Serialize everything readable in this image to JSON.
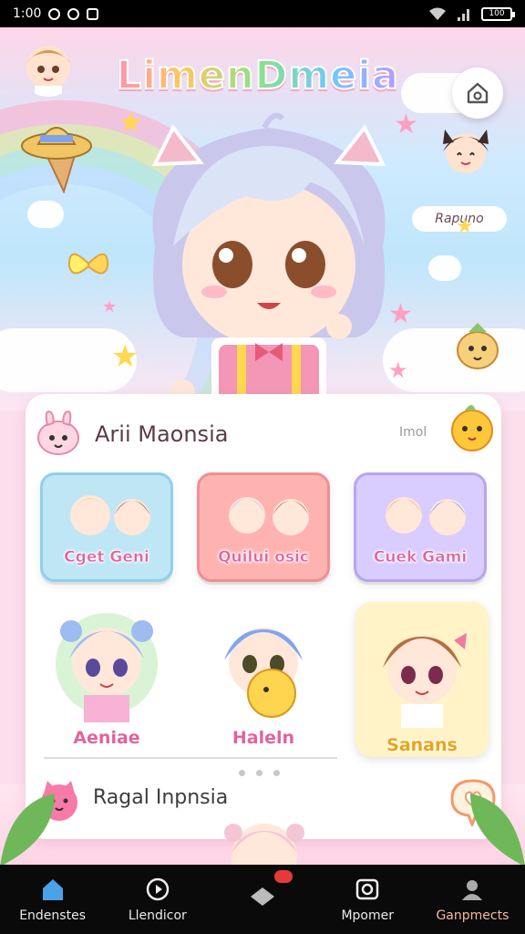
{
  "status_bar": {
    "time": "1:00",
    "battery": "100"
  },
  "app": {
    "title": "LimenDmeia",
    "mascot_label": "Rapuno"
  },
  "card": {
    "title": "Arii Maonsia",
    "aux_text": "Imol",
    "tiles": [
      {
        "label": "Cget Geni",
        "color": "#bfe6f5",
        "border": "#8ed0ee"
      },
      {
        "label": "Quilui osic",
        "color": "#ffb3b0",
        "border": "#f18e93"
      },
      {
        "label": "Cuek Gami",
        "color": "#d9ccff",
        "border": "#b6a6ef"
      }
    ],
    "characters": [
      {
        "label": "Aeniae"
      },
      {
        "label": "Haleln"
      },
      {
        "label": "Sanans"
      }
    ],
    "subtitle": "Ragal Inpnsia"
  },
  "bottom_nav": {
    "items": [
      {
        "label": "Endenstes",
        "icon": "home-icon"
      },
      {
        "label": "Llendicor",
        "icon": "play-icon"
      },
      {
        "label": "",
        "icon": "diamond-icon"
      },
      {
        "label": "Mpomer",
        "icon": "camera-icon"
      },
      {
        "label": "Ganpmects",
        "icon": "profile-icon"
      }
    ]
  },
  "colors": {
    "accent_pink": "#e0649c",
    "nav_bg": "#0a0a0a",
    "active_tab": "#4aa3e8"
  }
}
